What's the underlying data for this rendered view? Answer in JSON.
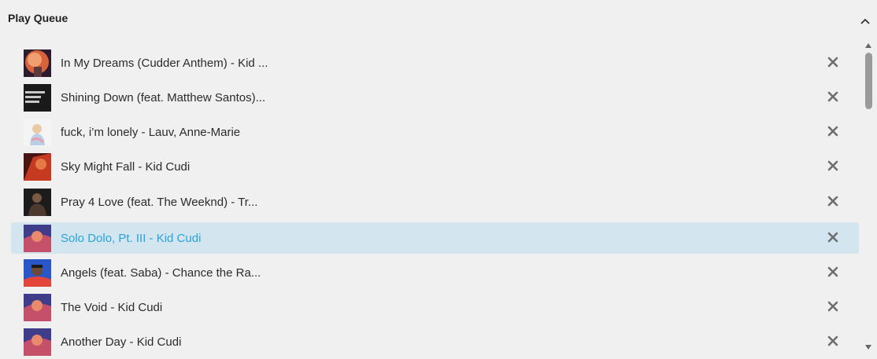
{
  "panel": {
    "title": "Play Queue",
    "collapse_icon": "chevron-up-icon"
  },
  "queue": {
    "items": [
      {
        "label": "In My Dreams (Cudder Anthem) - Kid ...",
        "art": "album-art-man-on-the-moon"
      },
      {
        "label": "Shining Down (feat. Matthew Santos)...",
        "art": "album-art-lupe-fiasco"
      },
      {
        "label": "fuck, i’m lonely - Lauv, Anne-Marie",
        "art": "album-art-lauv"
      },
      {
        "label": "Sky Might Fall - Kid Cudi",
        "art": "album-art-kid-cudi-red"
      },
      {
        "label": "Pray 4 Love (feat. The Weeknd) - Tr...",
        "art": "album-art-travis-scott"
      },
      {
        "label": "Solo Dolo, Pt. III - Kid Cudi",
        "art": "album-art-man-on-the-moon-3",
        "active": true
      },
      {
        "label": "Angels (feat. Saba) - Chance the Ra...",
        "art": "album-art-chance-the-rapper"
      },
      {
        "label": "The Void - Kid Cudi",
        "art": "album-art-man-on-the-moon-3"
      },
      {
        "label": "Another Day - Kid Cudi",
        "art": "album-art-man-on-the-moon-3"
      }
    ],
    "remove_icon": "close-icon",
    "active_color": "#2aa3d9",
    "active_background": "#d3e5ef"
  },
  "scrollbar": {
    "up_icon": "triangle-up-icon",
    "down_icon": "triangle-down-icon"
  }
}
